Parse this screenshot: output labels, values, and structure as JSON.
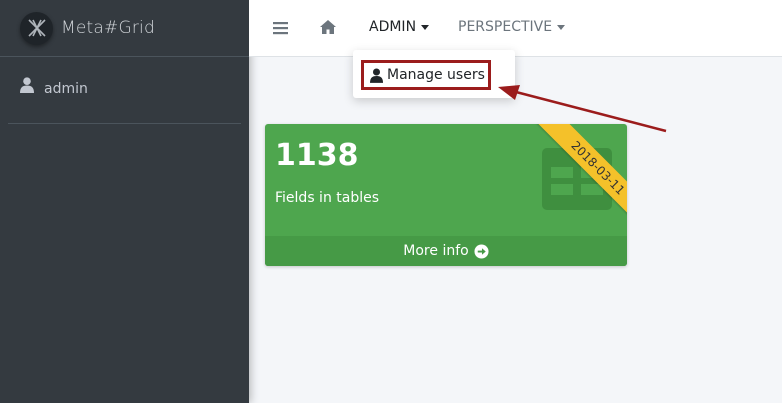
{
  "brand": {
    "name": "Meta#Grid",
    "logo_icon": "metagrid-logo-icon"
  },
  "sidebar": {
    "user": {
      "name": "admin",
      "icon": "user-icon"
    }
  },
  "navbar": {
    "menu_icon": "hamburger-icon",
    "home_icon": "home-icon",
    "admin_label": "ADMIN",
    "perspective_label": "PERSPECTIVE"
  },
  "dropdown": {
    "items": [
      {
        "label": "Manage users",
        "icon": "user-icon"
      }
    ]
  },
  "annotation": {
    "arrow_color": "#9b1c1c",
    "highlight_color": "#9b1c1c"
  },
  "info_box": {
    "number": "1138",
    "label": "Fields in tables",
    "ribbon": "2018-03-11",
    "footer_label": "More info",
    "footer_icon": "arrow-circle-right-icon",
    "icon": "table-icon",
    "color": "#4ea64e",
    "ribbon_color": "#f4c12a"
  },
  "colors": {
    "sidebar_bg": "#343a40",
    "content_bg": "#f4f6f9"
  }
}
